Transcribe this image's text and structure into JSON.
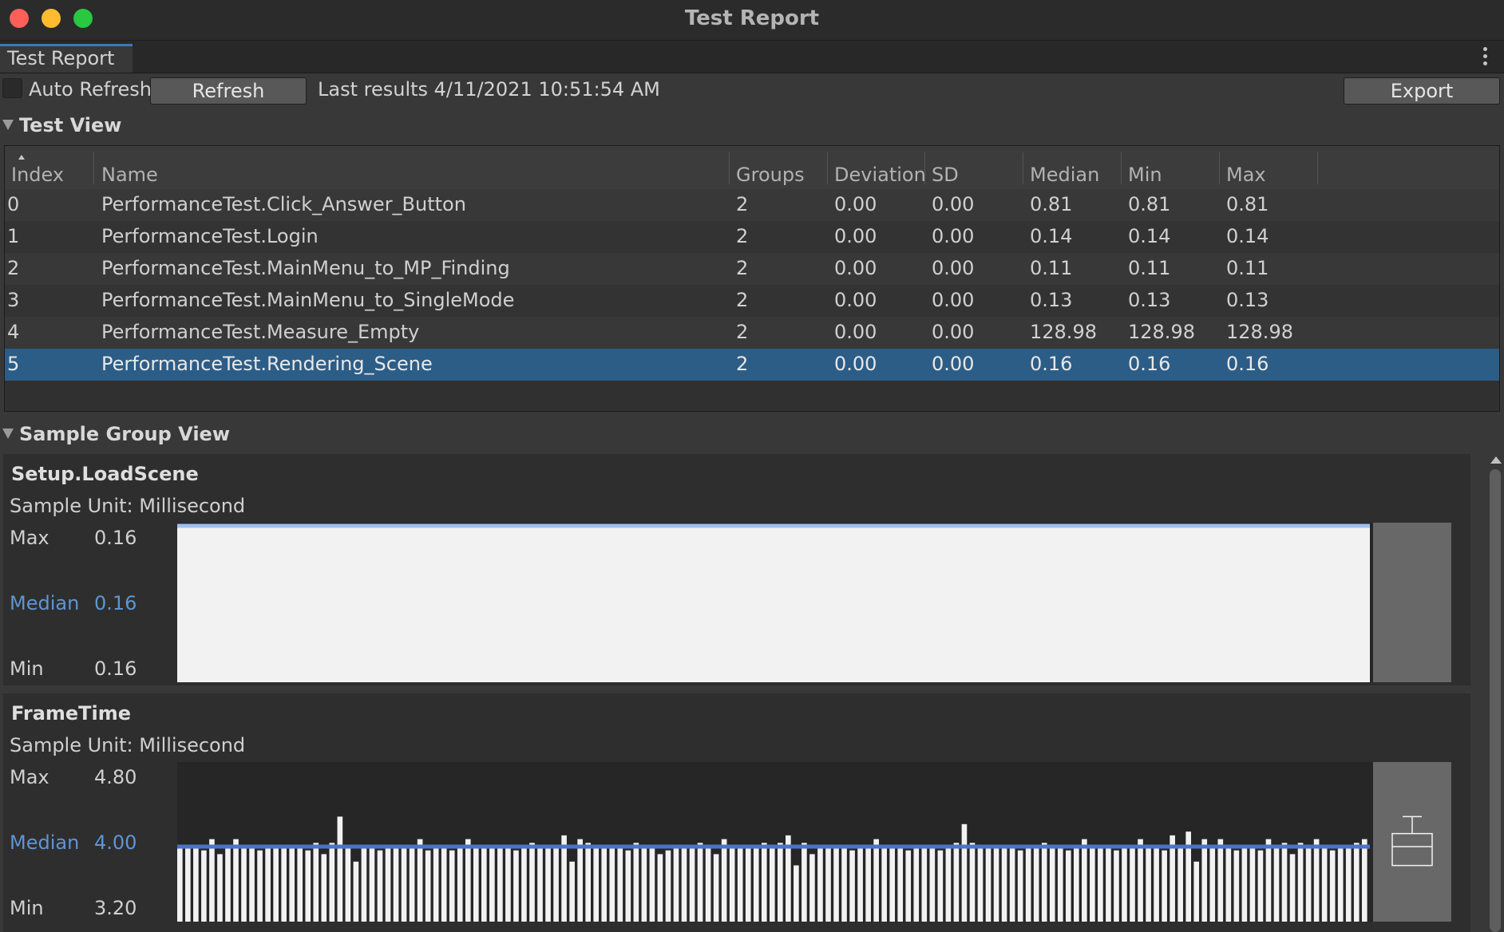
{
  "window": {
    "title": "Test Report"
  },
  "tab": {
    "label": "Test Report"
  },
  "toolbar": {
    "auto_refresh_label": "Auto Refresh",
    "auto_refresh_checked": false,
    "refresh_label": "Refresh",
    "last_results": "Last results 4/11/2021 10:51:54 AM",
    "export_label": "Export"
  },
  "test_view": {
    "title": "Test View",
    "columns": [
      "Index",
      "Name",
      "Groups",
      "Deviation",
      "SD",
      "Median",
      "Min",
      "Max"
    ],
    "rows": [
      [
        "0",
        "PerformanceTest.Click_Answer_Button",
        "2",
        "0.00",
        "0.00",
        "0.81",
        "0.81",
        "0.81"
      ],
      [
        "1",
        "PerformanceTest.Login",
        "2",
        "0.00",
        "0.00",
        "0.14",
        "0.14",
        "0.14"
      ],
      [
        "2",
        "PerformanceTest.MainMenu_to_MP_Finding",
        "2",
        "0.00",
        "0.00",
        "0.11",
        "0.11",
        "0.11"
      ],
      [
        "3",
        "PerformanceTest.MainMenu_to_SingleMode",
        "2",
        "0.00",
        "0.00",
        "0.13",
        "0.13",
        "0.13"
      ],
      [
        "4",
        "PerformanceTest.Measure_Empty",
        "2",
        "0.00",
        "0.00",
        "128.98",
        "128.98",
        "128.98"
      ],
      [
        "5",
        "PerformanceTest.Rendering_Scene",
        "2",
        "0.00",
        "0.00",
        "0.16",
        "0.16",
        "0.16"
      ]
    ],
    "selected_index": 5
  },
  "sample_group_view": {
    "title": "Sample Group View",
    "groups": [
      {
        "name": "Setup.LoadScene",
        "unit": "Sample Unit: Millisecond",
        "max_label": "Max",
        "max": "0.16",
        "median_label": "Median",
        "median": "0.16",
        "min_label": "Min",
        "min": "0.16"
      },
      {
        "name": "FrameTime",
        "unit": "Sample Unit: Millisecond",
        "max_label": "Max",
        "max": "4.80",
        "median_label": "Median",
        "median": "4.00",
        "min_label": "Min",
        "min": "3.20"
      }
    ]
  },
  "colors": {
    "median": "#5f95d4",
    "selection": "#2c5d87",
    "bar": "#f2f2f2",
    "median_line": "#4a74c4"
  },
  "chart_data": [
    {
      "type": "bar",
      "title": "Setup.LoadScene",
      "ylim": [
        0.16,
        0.16
      ],
      "values": [
        0.16
      ],
      "median": 0.16
    },
    {
      "type": "bar",
      "title": "FrameTime",
      "ylim": [
        3.2,
        4.8
      ],
      "median": 4.0,
      "values": [
        4.0,
        4.02,
        4.02,
        3.96,
        4.08,
        3.92,
        4.02,
        4.08,
        4.02,
        4.02,
        3.96,
        4.0,
        4.0,
        4.02,
        4.02,
        4.0,
        3.96,
        4.04,
        3.92,
        4.04,
        4.32,
        4.0,
        3.84,
        4.0,
        4.0,
        3.96,
        4.0,
        4.02,
        4.02,
        4.0,
        4.08,
        3.96,
        4.02,
        4.02,
        3.96,
        4.02,
        4.08,
        4.0,
        4.02,
        4.02,
        4.02,
        4.0,
        3.96,
        4.02,
        4.04,
        4.0,
        4.02,
        4.02,
        4.12,
        3.84,
        4.08,
        4.04,
        4.0,
        4.02,
        4.0,
        4.02,
        3.96,
        4.04,
        4.02,
        4.02,
        3.92,
        3.96,
        4.0,
        4.02,
        4.02,
        4.04,
        4.02,
        3.92,
        4.08,
        4.0,
        4.0,
        4.02,
        4.0,
        4.04,
        4.02,
        4.04,
        4.12,
        3.8,
        4.04,
        3.92,
        4.02,
        4.0,
        4.02,
        4.02,
        3.96,
        4.02,
        4.0,
        4.08,
        4.0,
        4.02,
        4.0,
        3.96,
        4.02,
        4.0,
        4.02,
        3.96,
        4.0,
        4.04,
        4.24,
        4.04,
        4.02,
        4.02,
        4.0,
        4.0,
        4.02,
        3.96,
        4.02,
        4.0,
        4.04,
        4.02,
        4.0,
        3.96,
        4.02,
        4.08,
        4.0,
        4.02,
        4.02,
        3.96,
        4.02,
        4.0,
        4.08,
        4.02,
        4.0,
        3.96,
        4.12,
        4.0,
        4.16,
        3.84,
        4.08,
        4.02,
        4.08,
        4.0,
        3.96,
        4.02,
        4.02,
        3.96,
        4.08,
        4.02,
        4.04,
        3.92,
        4.04,
        4.02,
        4.08,
        4.02,
        3.96,
        4.02,
        4.0,
        4.04,
        4.08
      ]
    }
  ]
}
